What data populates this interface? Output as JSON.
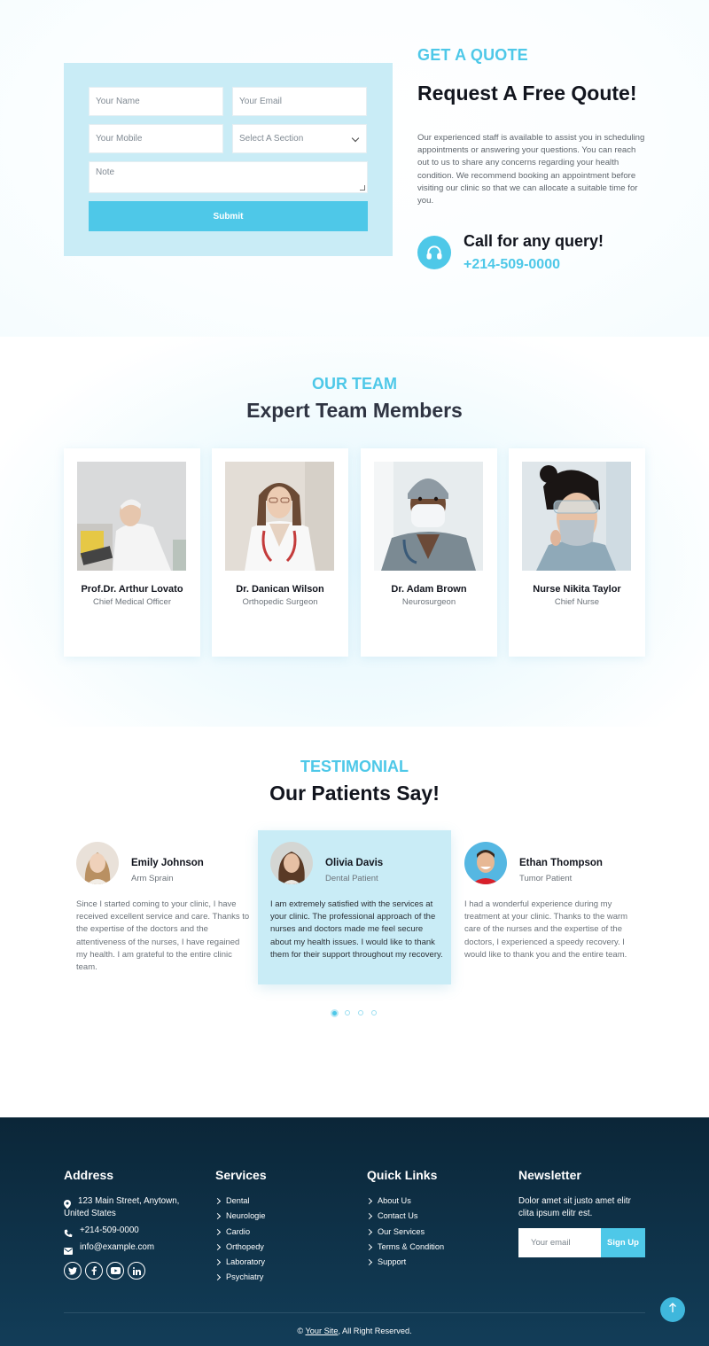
{
  "colors": {
    "accent": "#4ec8e8",
    "form_bg": "#c9ecf6",
    "footer_bg": "#0f3450",
    "heading": "#12151e"
  },
  "quote": {
    "eyebrow": "GET A QUOTE",
    "title": "Request A Free Qoute!",
    "description": "Our experienced staff is available to assist you in scheduling appointments or answering your questions. You can reach out to us to share any concerns regarding your health condition. We recommend booking an appointment before visiting our clinic so that we can allocate a suitable time for you.",
    "call_title": "Call for any query!",
    "call_phone": "+214-509-0000",
    "call_icon": "headphones-icon",
    "form": {
      "name_placeholder": "Your Name",
      "email_placeholder": "Your Email",
      "mobile_placeholder": "Your Mobile",
      "section_selected": "Select A Section",
      "note_placeholder": "Note",
      "submit_label": "Submit"
    }
  },
  "team": {
    "eyebrow": "OUR TEAM",
    "title": "Expert Team Members",
    "members": [
      {
        "name": "Prof.Dr. Arthur Lovato",
        "role": "Chief Medical Officer"
      },
      {
        "name": "Dr. Danican Wilson",
        "role": "Orthopedic Surgeon"
      },
      {
        "name": "Dr. Adam Brown",
        "role": "Neurosurgeon"
      },
      {
        "name": "Nurse Nikita Taylor",
        "role": "Chief Nurse"
      }
    ]
  },
  "testimonial": {
    "eyebrow": "TESTIMONIAL",
    "title": "Our Patients Say!",
    "items": [
      {
        "name": "Emily Johnson",
        "role": "Arm Sprain",
        "text": "Since I started coming to your clinic, I have received excellent service and care. Thanks to the expertise of the doctors and the attentiveness of the nurses, I have regained my health. I am grateful to the entire clinic team."
      },
      {
        "name": "Olivia Davis",
        "role": "Dental Patient",
        "text": "I am extremely satisfied with the services at your clinic. The professional approach of the nurses and doctors made me feel secure about my health issues. I would like to thank them for their support throughout my recovery."
      },
      {
        "name": "Ethan Thompson",
        "role": "Tumor Patient",
        "text": "I had a wonderful experience during my treatment at your clinic. Thanks to the warm care of the nurses and the expertise of the doctors, I experienced a speedy recovery. I would like to thank you and the entire team."
      }
    ],
    "active_index": 1,
    "page_count": 4
  },
  "footer": {
    "address": {
      "heading": "Address",
      "street": "123 Main Street, Anytown, United States",
      "phone": "+214-509-0000",
      "email": "info@example.com",
      "social": [
        "twitter-icon",
        "facebook-icon",
        "youtube-icon",
        "linkedin-icon"
      ]
    },
    "services": {
      "heading": "Services",
      "links": [
        "Dental",
        "Neurologie",
        "Cardio",
        "Orthopedy",
        "Laboratory",
        "Psychiatry"
      ]
    },
    "quick_links": {
      "heading": "Quick Links",
      "links": [
        "About Us",
        "Contact Us",
        "Our Services",
        "Terms & Condition",
        "Support"
      ]
    },
    "newsletter": {
      "heading": "Newsletter",
      "text": "Dolor amet sit justo amet elitr clita ipsum elitr est.",
      "email_placeholder": "Your email",
      "button_label": "Sign Up"
    },
    "copyright_prefix": "©",
    "site_link": "Your Site",
    "copyright_suffix": ", All Right Reserved."
  }
}
